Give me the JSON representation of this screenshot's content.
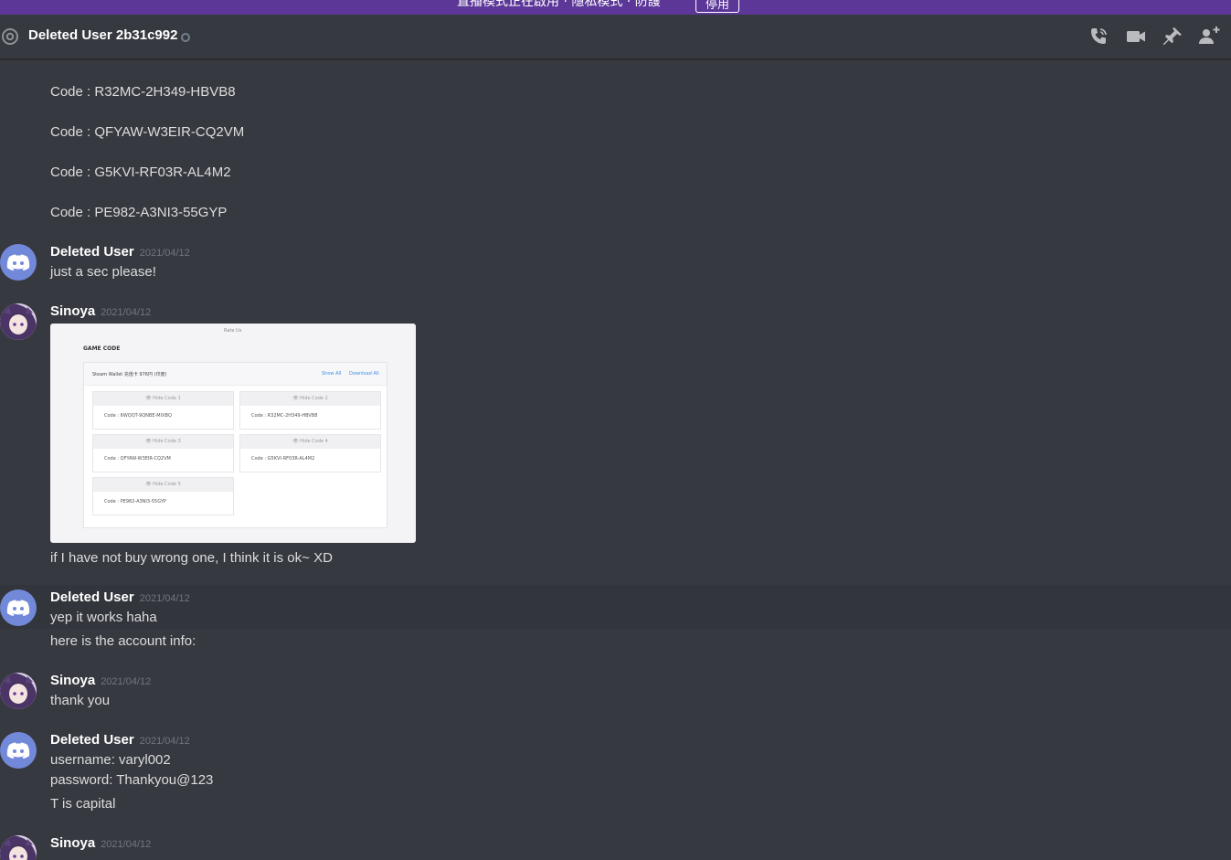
{
  "banner": {
    "text": "直播模式正在啟用 · 隱私模式 · 防護",
    "button_label": "停用",
    "color": "#5c3798"
  },
  "header": {
    "title": "Deleted User 2b31c992",
    "icons": [
      "at-icon",
      "phone-call-icon",
      "video-camera-icon",
      "pin-icon",
      "add-friend-icon"
    ]
  },
  "messages": {
    "codes": [
      "Code : R32MC-2H349-HBVB8",
      "Code : QFYAW-W3EIR-CQ2VM",
      "Code : G5KVI-RF03R-AL4M2",
      "Code : PE982-A3NI3-55GYP"
    ],
    "m1": {
      "author": "Deleted User",
      "timestamp": "2021/04/12",
      "text": "just a sec please!"
    },
    "m2": {
      "author": "Sinoya",
      "timestamp": "2021/04/12",
      "text": "if I have not buy wrong one, I think it is ok~ XD"
    },
    "m3": {
      "author": "Deleted User",
      "timestamp": "2021/04/12",
      "text": "yep it works haha",
      "text2": "here is the account info:"
    },
    "m4": {
      "author": "Sinoya",
      "timestamp": "2021/04/12",
      "text": "thank you"
    },
    "m5": {
      "author": "Deleted User",
      "timestamp": "2021/04/12",
      "text": "username: varyl002",
      "text2": "password: Thankyou@123",
      "text3": "T is capital"
    },
    "m6": {
      "author": "Sinoya",
      "timestamp": "2021/04/12"
    }
  },
  "embed": {
    "rate_us": "Rate Us",
    "heading": "GAME CODE",
    "card_title": "Steam Wallet 充值卡 976円 (印度)",
    "show_all": "Show All",
    "download_all": "Download All",
    "items": [
      {
        "head": "👁 Hide Code 1",
        "code": "Code : 6WQQT-9QNBE-MIXBQ"
      },
      {
        "head": "👁 Hide Code 2",
        "code": "Code : R32MC-2H349-HBVB8"
      },
      {
        "head": "👁 Hide Code 3",
        "code": "Code : QFYAW-W3EIR-CQ2VM"
      },
      {
        "head": "👁 Hide Code 4",
        "code": "Code : G5KVI-RF03R-AL4M2"
      },
      {
        "head": "👁 Hide Code 5",
        "code": "Code : PE982-A3NI3-55GYP"
      }
    ]
  },
  "colors": {
    "background": "#36393f",
    "text": "#dcddde",
    "author": "#ffffff",
    "timestamp": "#72767d",
    "discord_avatar": "#7289da"
  }
}
